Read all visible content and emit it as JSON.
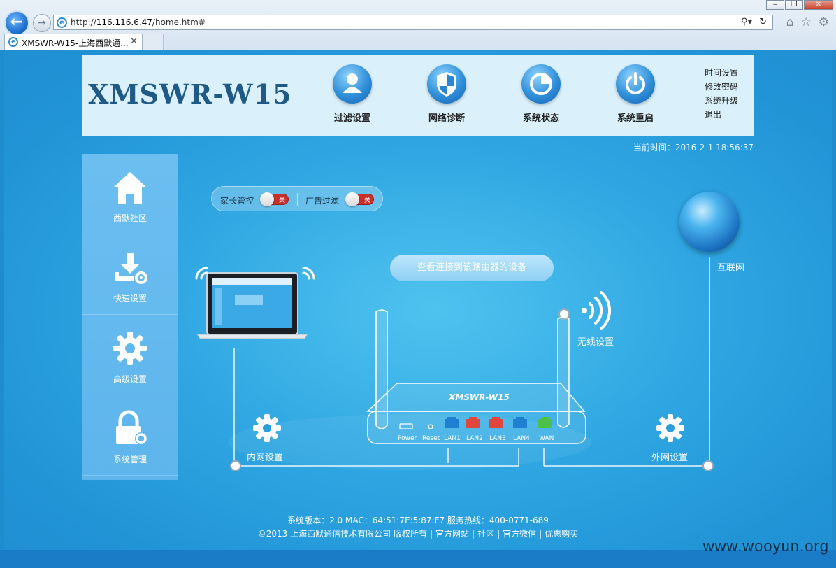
{
  "browser": {
    "url_prefix": "http://",
    "url_host": "116.116.6.47",
    "url_path": "/home.htm#",
    "tab_title": "XMSWR-W15-上海西默通...",
    "tab_close": "✕",
    "window_buttons": [
      "‒",
      "❐",
      "✕"
    ]
  },
  "header": {
    "logo": "XMSWR-W15",
    "nav": [
      {
        "label": "过滤设置"
      },
      {
        "label": "网络诊断"
      },
      {
        "label": "系统状态"
      },
      {
        "label": "系统重启"
      }
    ],
    "links": [
      "时间设置",
      "修改密码",
      "系统升级",
      "退出"
    ]
  },
  "current_time": "当前时间：2016-2-1 18:56:37",
  "sidebar": {
    "items": [
      {
        "label": "西默社区"
      },
      {
        "label": "快速设置"
      },
      {
        "label": "高级设置"
      },
      {
        "label": "系统管理"
      }
    ]
  },
  "toggles": {
    "parental": {
      "label": "家长管控",
      "state": "关"
    },
    "adfilter": {
      "label": "广告过滤",
      "state": "关"
    }
  },
  "view_devices": "查看连接到该路由器的设备",
  "diagram": {
    "internet": "互联网",
    "wireless": "无线设置",
    "lan": "内网设置",
    "wan": "外网设置",
    "router_model": "XMSWR-W15",
    "ports": [
      "Power",
      "Reset",
      "LAN1",
      "LAN2",
      "LAN3",
      "LAN4",
      "WAN"
    ],
    "port_colors": {
      "lan1": "#1f7fd1",
      "lan2": "#e0463b",
      "lan3": "#e0463b",
      "lan4": "#1f7fd1",
      "wan": "#4cc24a"
    }
  },
  "footer": {
    "line1": "系统版本：2.0 MAC：64:51:7E:5:87:F7 服务热线：400-0771-689",
    "copyright": "©2013 上海西默通信技术有限公司 版权所有",
    "links": [
      "官方网站",
      "社区",
      "官方微信",
      "优惠购买"
    ]
  },
  "watermark": "www.wooyun.org"
}
